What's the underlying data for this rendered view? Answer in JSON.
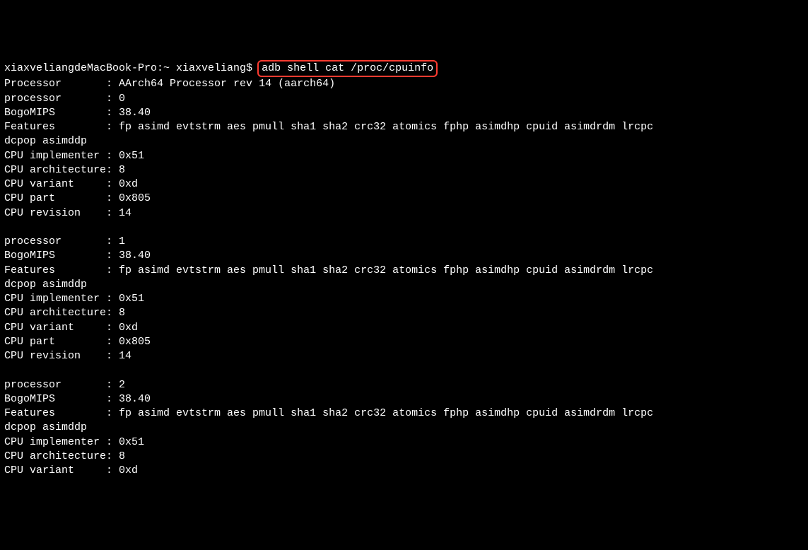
{
  "prompt": {
    "host_user": "xiaxveliangdeMacBook-Pro:~ xiaxveliang$ ",
    "command": "adb shell cat /proc/cpuinfo"
  },
  "header": {
    "processor_label": "Processor       : ",
    "processor_value": "AArch64 Processor rev 14 (aarch64)"
  },
  "cpu0": {
    "processor": "processor       : 0",
    "bogomips": "BogoMIPS        : 38.40",
    "features_line1": "Features        : fp asimd evtstrm aes pmull sha1 sha2 crc32 atomics fphp asimdhp cpuid asimdrdm lrcpc",
    "features_line2": "dcpop asimddp",
    "implementer": "CPU implementer : 0x51",
    "architecture": "CPU architecture: 8",
    "variant": "CPU variant     : 0xd",
    "part": "CPU part        : 0x805",
    "revision": "CPU revision    : 14"
  },
  "cpu1": {
    "processor": "processor       : 1",
    "bogomips": "BogoMIPS        : 38.40",
    "features_line1": "Features        : fp asimd evtstrm aes pmull sha1 sha2 crc32 atomics fphp asimdhp cpuid asimdrdm lrcpc",
    "features_line2": "dcpop asimddp",
    "implementer": "CPU implementer : 0x51",
    "architecture": "CPU architecture: 8",
    "variant": "CPU variant     : 0xd",
    "part": "CPU part        : 0x805",
    "revision": "CPU revision    : 14"
  },
  "cpu2": {
    "processor": "processor       : 2",
    "bogomips": "BogoMIPS        : 38.40",
    "features_line1": "Features        : fp asimd evtstrm aes pmull sha1 sha2 crc32 atomics fphp asimdhp cpuid asimdrdm lrcpc",
    "features_line2": "dcpop asimddp",
    "implementer": "CPU implementer : 0x51",
    "architecture": "CPU architecture: 8",
    "variant": "CPU variant     : 0xd"
  }
}
